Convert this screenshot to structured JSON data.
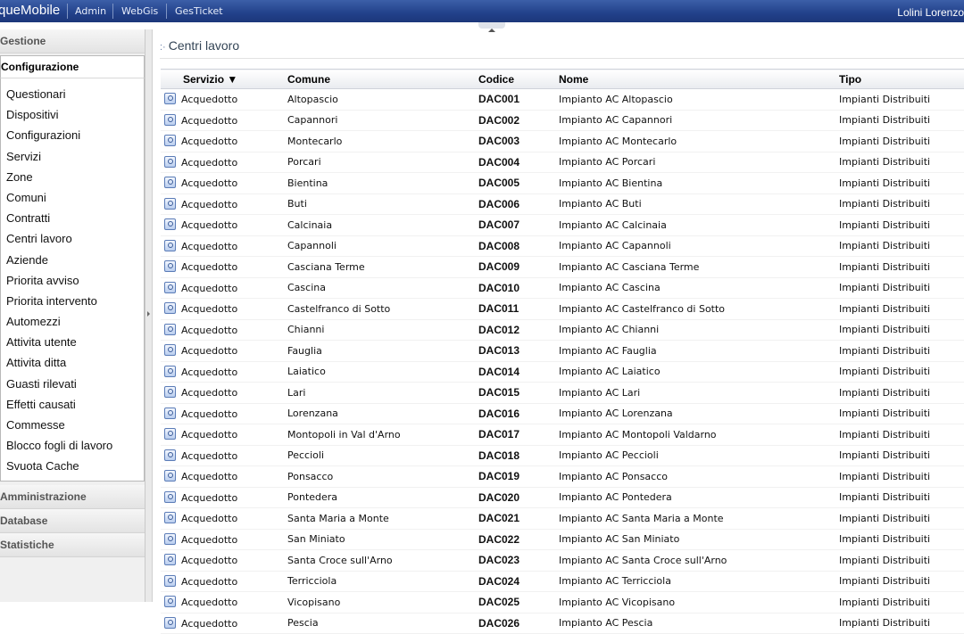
{
  "topbar": {
    "brand": "queMobile",
    "links": [
      "Admin",
      "WebGis",
      "GesTicket"
    ],
    "user": "Lolini Lorenzo"
  },
  "sidebar": {
    "sections": [
      "Gestione",
      "Configurazione",
      "Amministrazione",
      "Database",
      "Statistiche"
    ],
    "active_section": "Configurazione",
    "items": [
      "Questionari",
      "Dispositivi",
      "Configurazioni",
      "Servizi",
      "Zone",
      "Comuni",
      "Contratti",
      "Centri lavoro",
      "Aziende",
      "Priorita avviso",
      "Priorita intervento",
      "Automezzi",
      "Attivita utente",
      "Attivita ditta",
      "Guasti rilevati",
      "Effetti causati",
      "Commesse",
      "Blocco fogli di lavoro",
      "Svuota Cache"
    ]
  },
  "main": {
    "title": "Centri lavoro",
    "columns": [
      "Servizio ▼",
      "Comune",
      "Codice",
      "Nome",
      "Tipo"
    ],
    "rows": [
      [
        "Acquedotto",
        "Altopascio",
        "DAC001",
        "Impianto AC Altopascio",
        "Impianti Distribuiti"
      ],
      [
        "Acquedotto",
        "Capannori",
        "DAC002",
        "Impianto AC Capannori",
        "Impianti Distribuiti"
      ],
      [
        "Acquedotto",
        "Montecarlo",
        "DAC003",
        "Impianto AC Montecarlo",
        "Impianti Distribuiti"
      ],
      [
        "Acquedotto",
        "Porcari",
        "DAC004",
        "Impianto AC Porcari",
        "Impianti Distribuiti"
      ],
      [
        "Acquedotto",
        "Bientina",
        "DAC005",
        "Impianto AC Bientina",
        "Impianti Distribuiti"
      ],
      [
        "Acquedotto",
        "Buti",
        "DAC006",
        "Impianto AC Buti",
        "Impianti Distribuiti"
      ],
      [
        "Acquedotto",
        "Calcinaia",
        "DAC007",
        "Impianto AC Calcinaia",
        "Impianti Distribuiti"
      ],
      [
        "Acquedotto",
        "Capannoli",
        "DAC008",
        "Impianto AC Capannoli",
        "Impianti Distribuiti"
      ],
      [
        "Acquedotto",
        "Casciana Terme",
        "DAC009",
        "Impianto AC Casciana Terme",
        "Impianti Distribuiti"
      ],
      [
        "Acquedotto",
        "Cascina",
        "DAC010",
        "Impianto AC Cascina",
        "Impianti Distribuiti"
      ],
      [
        "Acquedotto",
        "Castelfranco di Sotto",
        "DAC011",
        "Impianto AC Castelfranco di Sotto",
        "Impianti Distribuiti"
      ],
      [
        "Acquedotto",
        "Chianni",
        "DAC012",
        "Impianto AC Chianni",
        "Impianti Distribuiti"
      ],
      [
        "Acquedotto",
        "Fauglia",
        "DAC013",
        "Impianto AC Fauglia",
        "Impianti Distribuiti"
      ],
      [
        "Acquedotto",
        "Laiatico",
        "DAC014",
        "Impianto AC Laiatico",
        "Impianti Distribuiti"
      ],
      [
        "Acquedotto",
        "Lari",
        "DAC015",
        "Impianto AC Lari",
        "Impianti Distribuiti"
      ],
      [
        "Acquedotto",
        "Lorenzana",
        "DAC016",
        "Impianto AC Lorenzana",
        "Impianti Distribuiti"
      ],
      [
        "Acquedotto",
        "Montopoli in Val d'Arno",
        "DAC017",
        "Impianto AC Montopoli Valdarno",
        "Impianti Distribuiti"
      ],
      [
        "Acquedotto",
        "Peccioli",
        "DAC018",
        "Impianto AC Peccioli",
        "Impianti Distribuiti"
      ],
      [
        "Acquedotto",
        "Ponsacco",
        "DAC019",
        "Impianto AC Ponsacco",
        "Impianti Distribuiti"
      ],
      [
        "Acquedotto",
        "Pontedera",
        "DAC020",
        "Impianto AC Pontedera",
        "Impianti Distribuiti"
      ],
      [
        "Acquedotto",
        "Santa Maria a Monte",
        "DAC021",
        "Impianto AC Santa Maria a Monte",
        "Impianti Distribuiti"
      ],
      [
        "Acquedotto",
        "San Miniato",
        "DAC022",
        "Impianto AC San Miniato",
        "Impianti Distribuiti"
      ],
      [
        "Acquedotto",
        "Santa Croce sull'Arno",
        "DAC023",
        "Impianto AC Santa Croce sull'Arno",
        "Impianti Distribuiti"
      ],
      [
        "Acquedotto",
        "Terricciola",
        "DAC024",
        "Impianto AC Terricciola",
        "Impianti Distribuiti"
      ],
      [
        "Acquedotto",
        "Vicopisano",
        "DAC025",
        "Impianto AC Vicopisano",
        "Impianti Distribuiti"
      ],
      [
        "Acquedotto",
        "Pescia",
        "DAC026",
        "Impianto AC Pescia",
        "Impianti Distribuiti"
      ]
    ]
  },
  "colors": {
    "topbar": "#22418a",
    "sidebar_bg": "#f0f0f0",
    "title_text": "#334455"
  }
}
